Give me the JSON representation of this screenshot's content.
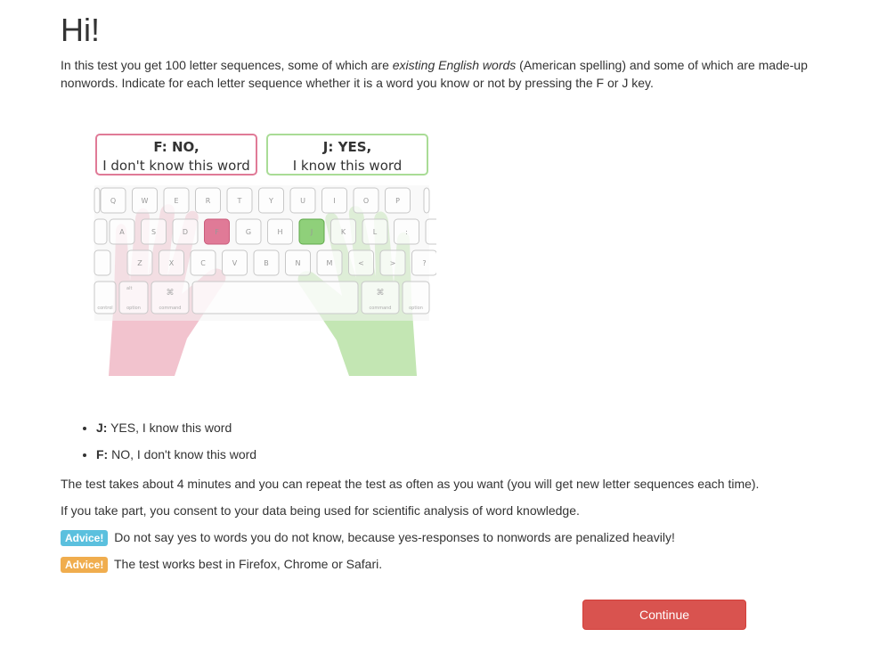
{
  "heading": "Hi!",
  "intro": {
    "part1": "In this test you get 100 letter sequences, some of which are ",
    "emphasis": "existing English words",
    "part2": " (American spelling) and some of which are made-up nonwords. Indicate for each letter sequence whether it is a word you know or not by pressing the F or J key."
  },
  "illustration": {
    "no_box": {
      "title": "F: NO,",
      "subtitle": "I don't know this word"
    },
    "yes_box": {
      "title": "J: YES,",
      "subtitle": "I know this word"
    },
    "keyboard": {
      "row1": [
        "Q",
        "W",
        "E",
        "R",
        "T",
        "Y",
        "U",
        "I",
        "O",
        "P"
      ],
      "row2": [
        "A",
        "S",
        "D",
        "F",
        "G",
        "H",
        "J",
        "K",
        "L",
        ":",
        ";"
      ],
      "row3": [
        "Z",
        "X",
        "C",
        "V",
        "B",
        "N",
        "M",
        "<",
        ">",
        "?"
      ],
      "highlight_no": "F",
      "highlight_yes": "J",
      "left_labels": [
        "control",
        "option",
        "command"
      ],
      "right_labels": [
        "command",
        "option"
      ],
      "alt_label": "alt",
      "cmd_symbol": "⌘"
    },
    "colors": {
      "no": "#e07a97",
      "yes": "#8fd07a",
      "no_hand": "#f0b8c6",
      "yes_hand": "#bde3ab"
    }
  },
  "keys_list": [
    {
      "key": "J:",
      "text": " YES, I know this word"
    },
    {
      "key": "F:",
      "text": " NO, I don't know this word"
    }
  ],
  "duration_text": "The test takes about 4 minutes and you can repeat the test as often as you want (you will get new letter sequences each time).",
  "consent_text": "If you take part, you consent to your data being used for scientific analysis of word knowledge.",
  "advice": [
    {
      "label": "Advice!",
      "text": "Do not say yes to words you do not know, because yes-responses to nonwords are penalized heavily!",
      "color": "#5bc0de"
    },
    {
      "label": "Advice!",
      "text": "The test works best in Firefox, Chrome or Safari.",
      "color": "#f0ad4e"
    }
  ],
  "continue_label": "Continue"
}
